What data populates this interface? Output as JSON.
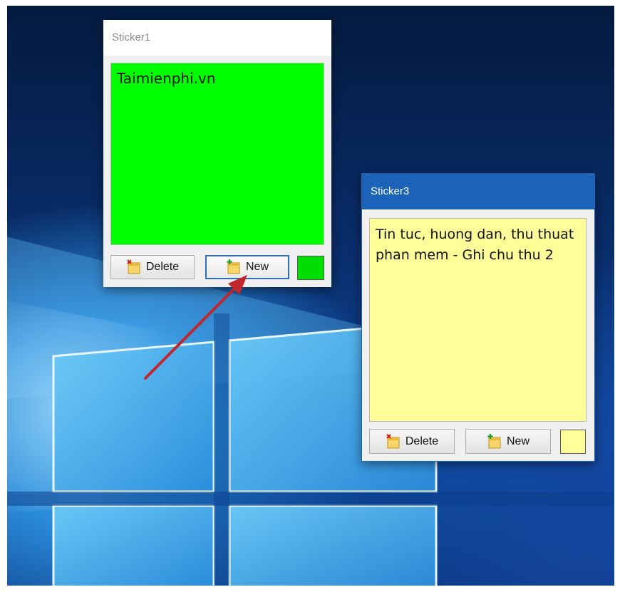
{
  "windows": [
    {
      "id": "sticker1",
      "title": "Sticker1",
      "note_text": "Taimienphi.vn",
      "note_color": "#00ff00",
      "delete_label": "Delete",
      "new_label": "New",
      "color_swatch": "#00dd00",
      "new_button_focused": true
    },
    {
      "id": "sticker3",
      "title": "Sticker3",
      "note_text": "Tin tuc, huong dan, thu thuat phan mem - Ghi chu thu 2",
      "note_color": "#ffff99",
      "delete_label": "Delete",
      "new_label": "New",
      "color_swatch": "#ffff99",
      "new_button_focused": false
    }
  ],
  "icons": {
    "delete_button_icon": "note-delete-icon",
    "new_button_icon": "note-new-icon"
  },
  "annotation": {
    "arrow_color": "#c0262d",
    "points_to": "sticker1-new-button"
  },
  "desktop": {
    "wallpaper": "windows-10-logo-light"
  }
}
